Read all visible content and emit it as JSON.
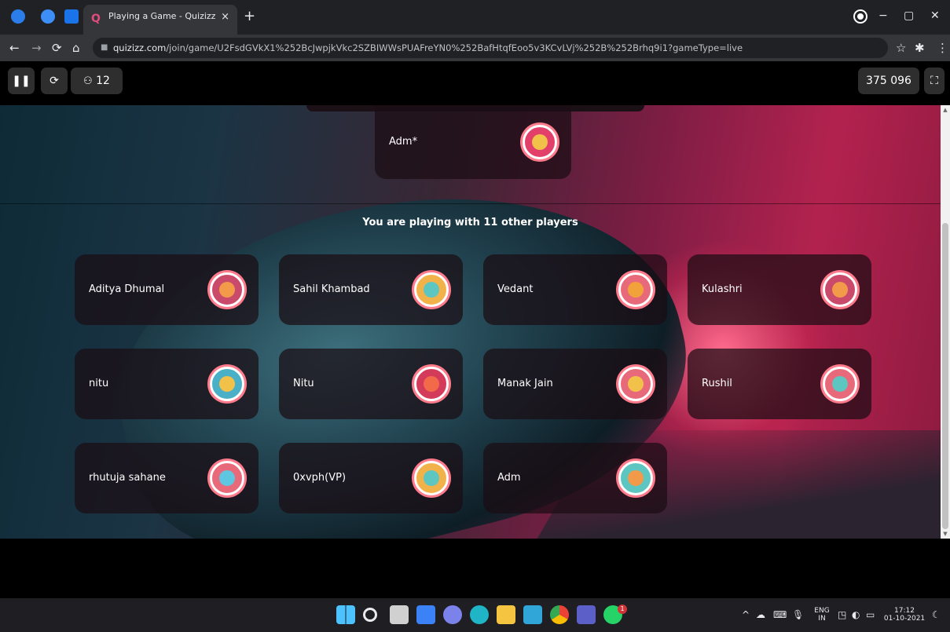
{
  "browser": {
    "tab_title": "Playing a Game - Quizizz",
    "tab_close": "×",
    "new_tab": "+",
    "url_host": "quizizz.com",
    "url_path": "/join/game/U2FsdGVkX1%252BcJwpjkVkc2SZBIWWsPUAFreYN0%252BafHtqfEoo5v3KCvLVj%252B%252Brhq9i1?gameType=live",
    "window_controls": {
      "minimize": "−",
      "maximize": "▢",
      "close": "✕"
    },
    "nav": {
      "back": "←",
      "forward": "→",
      "reload": "⟳",
      "home": "⌂"
    }
  },
  "game": {
    "player_count": "12",
    "score": "375 096",
    "current_player": "Adm*",
    "status_text": "You are playing with 11 other players",
    "players": [
      {
        "name": "Aditya Dhumal",
        "avatar_color": "#f29a4a",
        "avatar_bg": "#c94a6a"
      },
      {
        "name": "Sahil Khambad",
        "avatar_color": "#5ec6c0",
        "avatar_bg": "#f2b24a"
      },
      {
        "name": "Vedant",
        "avatar_color": "#f2a23a",
        "avatar_bg": "#e86a7a"
      },
      {
        "name": "Kulashri",
        "avatar_color": "#f29a4a",
        "avatar_bg": "#c94a6a"
      },
      {
        "name": "nitu",
        "avatar_color": "#f2c14a",
        "avatar_bg": "#4ab0c8"
      },
      {
        "name": "Nitu",
        "avatar_color": "#f26a4a",
        "avatar_bg": "#d43a5a"
      },
      {
        "name": "Manak Jain",
        "avatar_color": "#f2c14a",
        "avatar_bg": "#e86a7a"
      },
      {
        "name": "Rushil",
        "avatar_color": "#5ec6c0",
        "avatar_bg": "#e86a7a"
      },
      {
        "name": "rhutuja sahane",
        "avatar_color": "#5ec6e0",
        "avatar_bg": "#e86a7a"
      },
      {
        "name": "0xvph(VP)",
        "avatar_color": "#5ec6c0",
        "avatar_bg": "#f2b24a"
      },
      {
        "name": "Adm",
        "avatar_color": "#f29a4a",
        "avatar_bg": "#5ec6c0"
      }
    ],
    "current_avatar_color": "#f2c14a",
    "current_avatar_bg": "#e2406a"
  },
  "taskbar": {
    "lang_top": "ENG",
    "lang_bottom": "IN",
    "time": "17:12",
    "date": "01-10-2021",
    "whatsapp_badge": "1"
  },
  "colors": {
    "accent": "#e2406a",
    "card_bg": "rgba(26,13,20,0.72)"
  }
}
